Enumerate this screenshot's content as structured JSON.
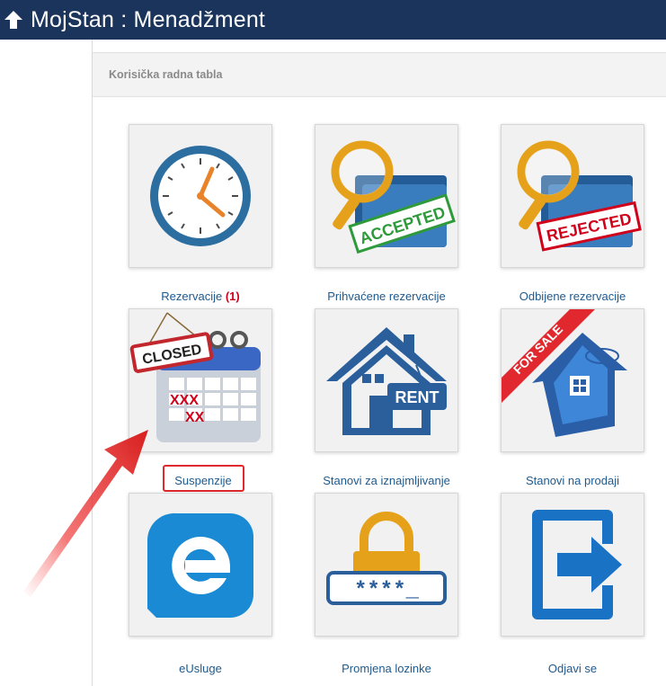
{
  "header": {
    "title": "MojStan : Menadžment",
    "bg_color": "#1b345c"
  },
  "breadcrumb": {
    "text": "Korisička radna tabla"
  },
  "tiles": [
    {
      "label": "Rezervacije",
      "badge": "(1)",
      "icon": "clock-icon"
    },
    {
      "label": "Prihvaćene rezervacije",
      "icon": "accepted-folder-icon",
      "stamp": "ACCEPTED"
    },
    {
      "label": "Odbijene rezervacije",
      "icon": "rejected-folder-icon",
      "stamp": "REJECTED"
    },
    {
      "label": "Suspenzije",
      "icon": "closed-calendar-icon",
      "sign": "CLOSED",
      "marks": [
        "XXX",
        "XX"
      ]
    },
    {
      "label": "Stanovi za iznajmljivanje",
      "icon": "house-rent-icon",
      "sign": "RENT"
    },
    {
      "label": "Stanovi na prodaji",
      "icon": "house-for-sale-icon",
      "ribbon": "FOR SALE"
    },
    {
      "label": "eUsluge",
      "icon": "e-services-icon"
    },
    {
      "label": "Promjena lozinke",
      "icon": "padlock-password-icon",
      "mask": "****_"
    },
    {
      "label": "Odjavi se",
      "icon": "logout-door-icon"
    }
  ],
  "annotation": {
    "arrow_color": "#e0282e",
    "highlighted_item": "Suspenzije"
  }
}
